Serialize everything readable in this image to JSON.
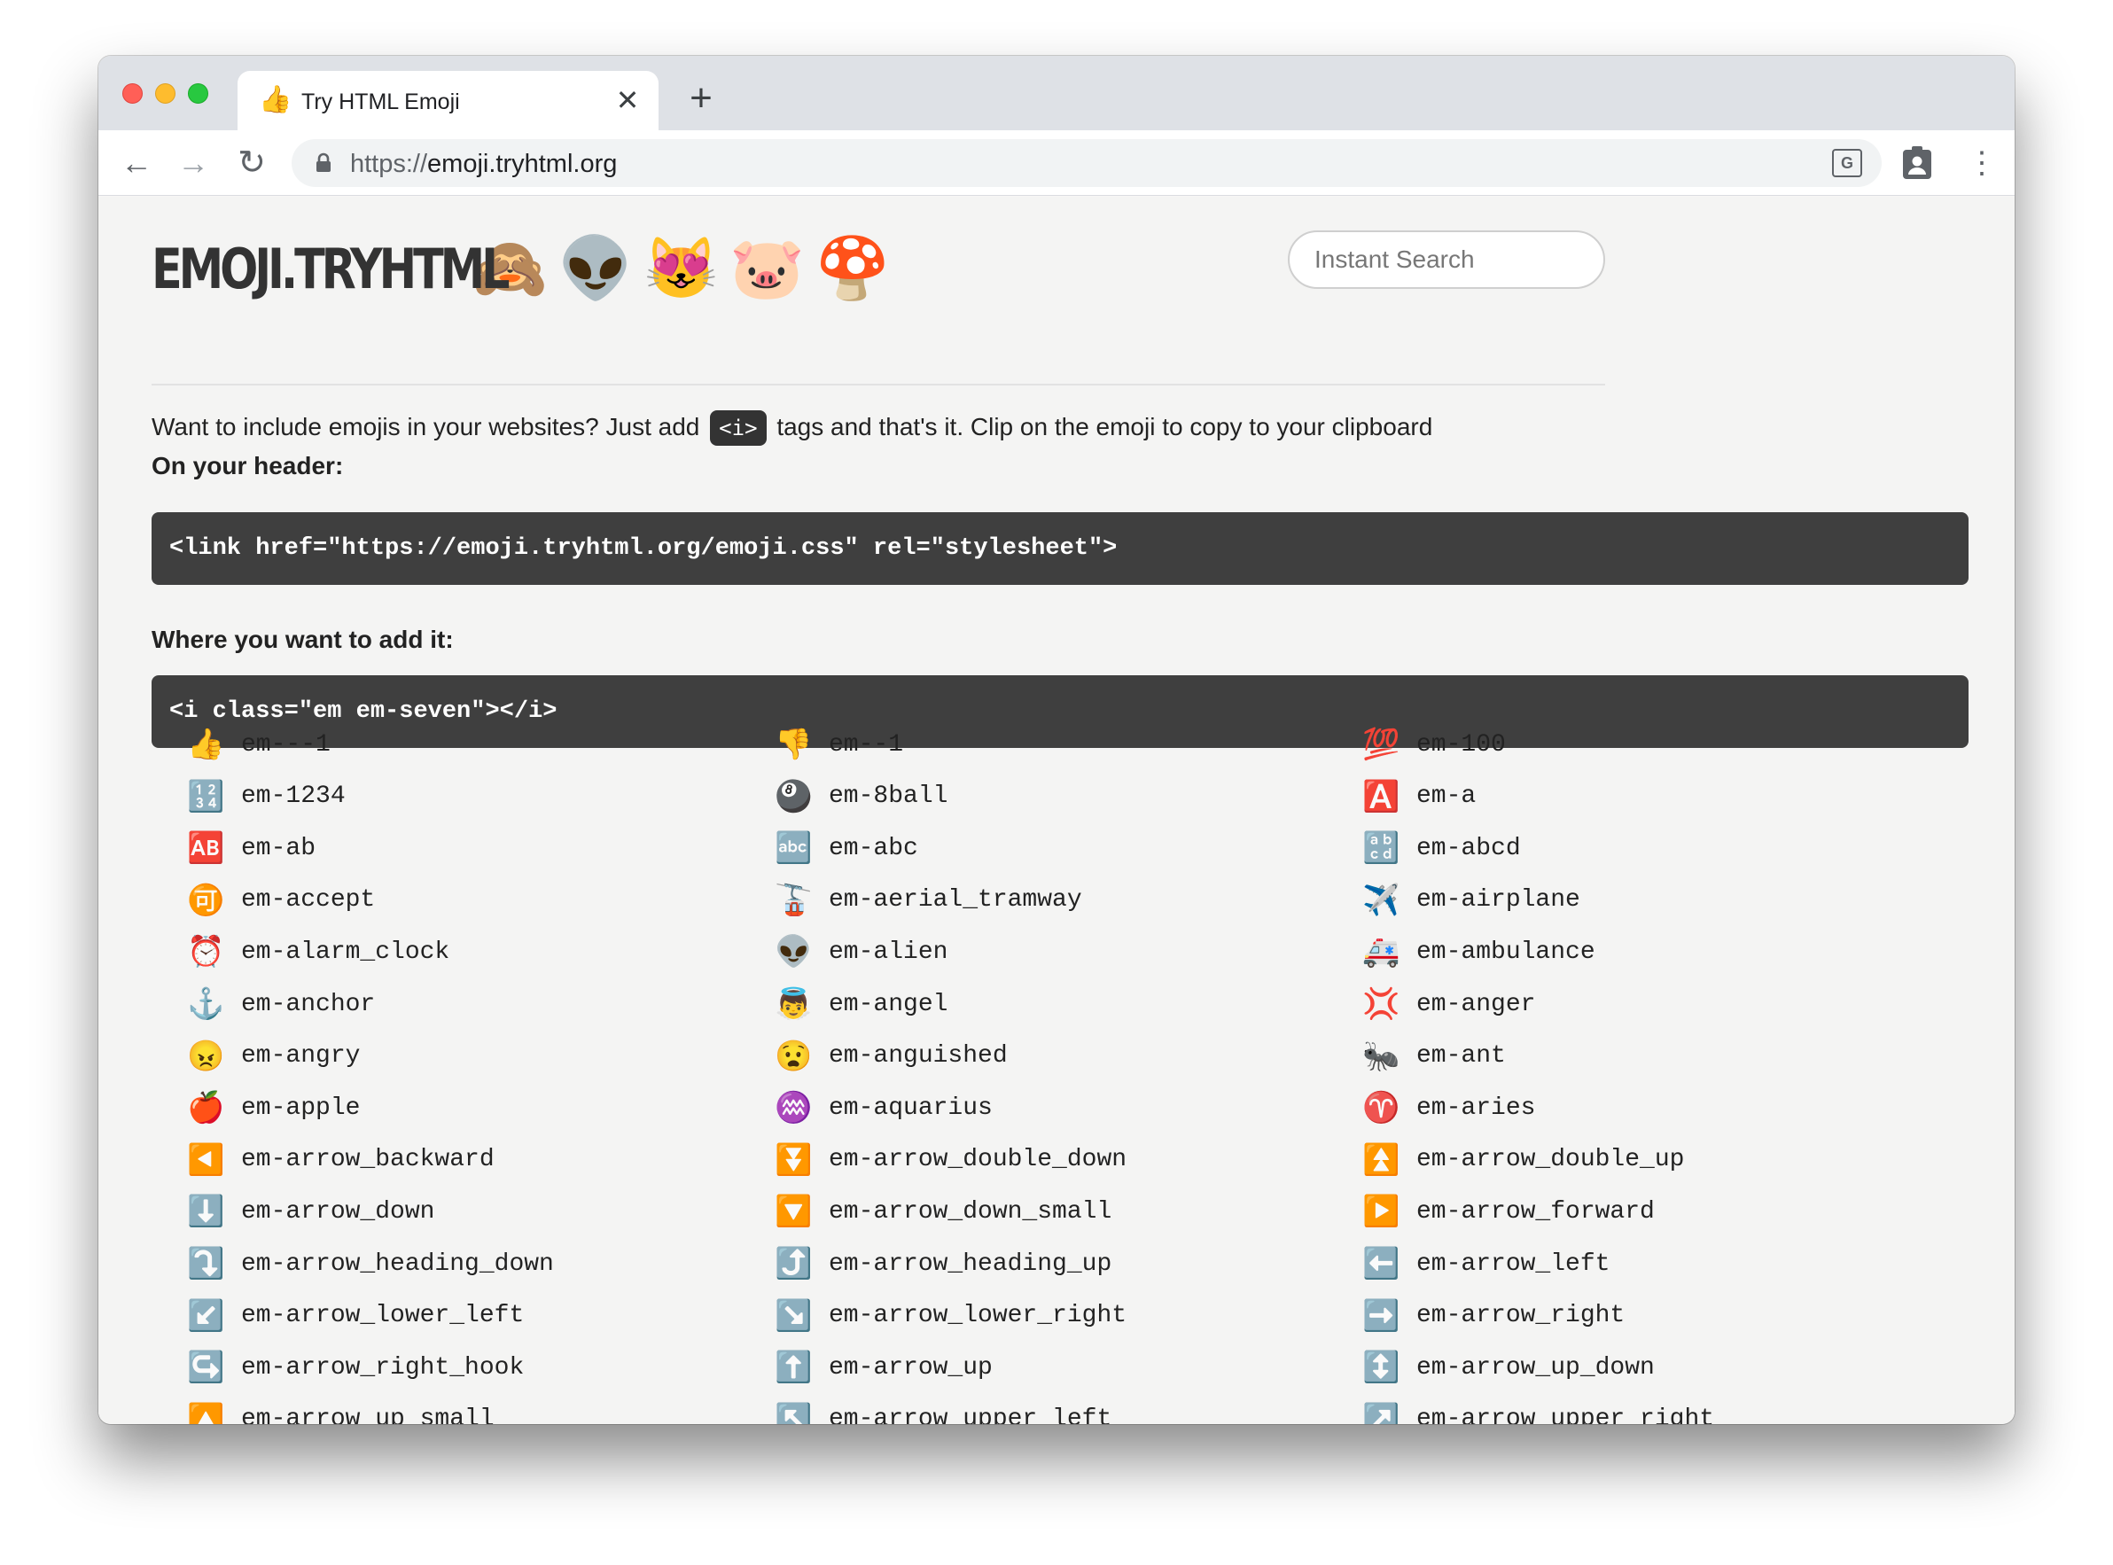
{
  "browser": {
    "tab": {
      "favicon": "👍",
      "title": "Try HTML Emoji",
      "close_label": "✕"
    },
    "newtab_label": "+",
    "nav": {
      "back": "←",
      "forward": "→",
      "reload": "↻"
    },
    "url_scheme": "https://",
    "url_host": "emoji.tryhtml.org",
    "translate_label": "G",
    "menu_label": "⋮"
  },
  "header": {
    "logo_text": "EMOJI.TRYHTML",
    "logo_emojis": [
      "🙈",
      "👽",
      "😻",
      "🐷",
      "🍄"
    ],
    "search_placeholder": "Instant Search"
  },
  "intro": {
    "before": "Want to include emojis in your websites? Just add",
    "chip": "<i>",
    "after": "tags and that's it. Clip on the emoji to copy to your clipboard"
  },
  "header_label": "On your header:",
  "header_code": "<link href=\"https://emoji.tryhtml.org/emoji.css\" rel=\"stylesheet\">",
  "add_label": "Where you want to add it:",
  "add_code": "<i class=\"em em-seven\"></i>",
  "emojis": [
    {
      "icon": "👍",
      "name": "em---1"
    },
    {
      "icon": "👎",
      "name": "em--1"
    },
    {
      "icon": "💯",
      "name": "em-100"
    },
    {
      "icon": "🔢",
      "name": "em-1234"
    },
    {
      "icon": "🎱",
      "name": "em-8ball"
    },
    {
      "icon": "🅰️",
      "name": "em-a"
    },
    {
      "icon": "🆎",
      "name": "em-ab"
    },
    {
      "icon": "🔤",
      "name": "em-abc"
    },
    {
      "icon": "🔡",
      "name": "em-abcd"
    },
    {
      "icon": "🉑",
      "name": "em-accept"
    },
    {
      "icon": "🚡",
      "name": "em-aerial_tramway"
    },
    {
      "icon": "✈️",
      "name": "em-airplane"
    },
    {
      "icon": "⏰",
      "name": "em-alarm_clock"
    },
    {
      "icon": "👽",
      "name": "em-alien"
    },
    {
      "icon": "🚑",
      "name": "em-ambulance"
    },
    {
      "icon": "⚓",
      "name": "em-anchor"
    },
    {
      "icon": "👼",
      "name": "em-angel"
    },
    {
      "icon": "💢",
      "name": "em-anger"
    },
    {
      "icon": "😠",
      "name": "em-angry"
    },
    {
      "icon": "😧",
      "name": "em-anguished"
    },
    {
      "icon": "🐜",
      "name": "em-ant"
    },
    {
      "icon": "🍎",
      "name": "em-apple"
    },
    {
      "icon": "♒",
      "name": "em-aquarius"
    },
    {
      "icon": "♈",
      "name": "em-aries"
    },
    {
      "icon": "◀️",
      "name": "em-arrow_backward"
    },
    {
      "icon": "⏬",
      "name": "em-arrow_double_down"
    },
    {
      "icon": "⏫",
      "name": "em-arrow_double_up"
    },
    {
      "icon": "⬇️",
      "name": "em-arrow_down"
    },
    {
      "icon": "🔽",
      "name": "em-arrow_down_small"
    },
    {
      "icon": "▶️",
      "name": "em-arrow_forward"
    },
    {
      "icon": "⤵️",
      "name": "em-arrow_heading_down"
    },
    {
      "icon": "⤴️",
      "name": "em-arrow_heading_up"
    },
    {
      "icon": "⬅️",
      "name": "em-arrow_left"
    },
    {
      "icon": "↙️",
      "name": "em-arrow_lower_left"
    },
    {
      "icon": "↘️",
      "name": "em-arrow_lower_right"
    },
    {
      "icon": "➡️",
      "name": "em-arrow_right"
    },
    {
      "icon": "↪️",
      "name": "em-arrow_right_hook"
    },
    {
      "icon": "⬆️",
      "name": "em-arrow_up"
    },
    {
      "icon": "↕️",
      "name": "em-arrow_up_down"
    },
    {
      "icon": "🔼",
      "name": "em-arrow_up_small"
    },
    {
      "icon": "↖️",
      "name": "em-arrow_upper_left"
    },
    {
      "icon": "↗️",
      "name": "em-arrow_upper_right"
    }
  ]
}
